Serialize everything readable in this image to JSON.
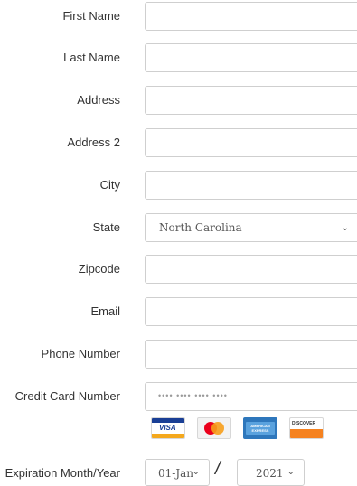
{
  "form": {
    "first_name_label": "First Name",
    "last_name_label": "Last Name",
    "address_label": "Address",
    "address2_label": "Address 2",
    "city_label": "City",
    "state_label": "State",
    "state_value": "North Carolina",
    "zipcode_label": "Zipcode",
    "email_label": "Email",
    "phone_label": "Phone Number",
    "credit_card_label": "Credit Card Number",
    "credit_card_placeholder": "•••• •••• •••• ••••",
    "card_logos": [
      "visa-icon",
      "mastercard-icon",
      "amex-icon",
      "discover-icon"
    ],
    "visa_text": "VISA",
    "amex_text": "AMERICAN EXPRESS",
    "discover_text": "DISCOVER",
    "expiration_label": "Expiration Month/Year",
    "expiration_month_value": "01-Jan",
    "expiration_separator": "/",
    "expiration_year_value": "2021"
  },
  "colors": {
    "label_text": "#333333",
    "field_border": "#cfcfcf",
    "visa_blue": "#1a3f95",
    "visa_gold": "#f4a81d",
    "mastercard_red": "#eb001b",
    "mastercard_orange": "#f79e1b",
    "amex_blue": "#2e77bc",
    "discover_orange": "#f58220"
  }
}
